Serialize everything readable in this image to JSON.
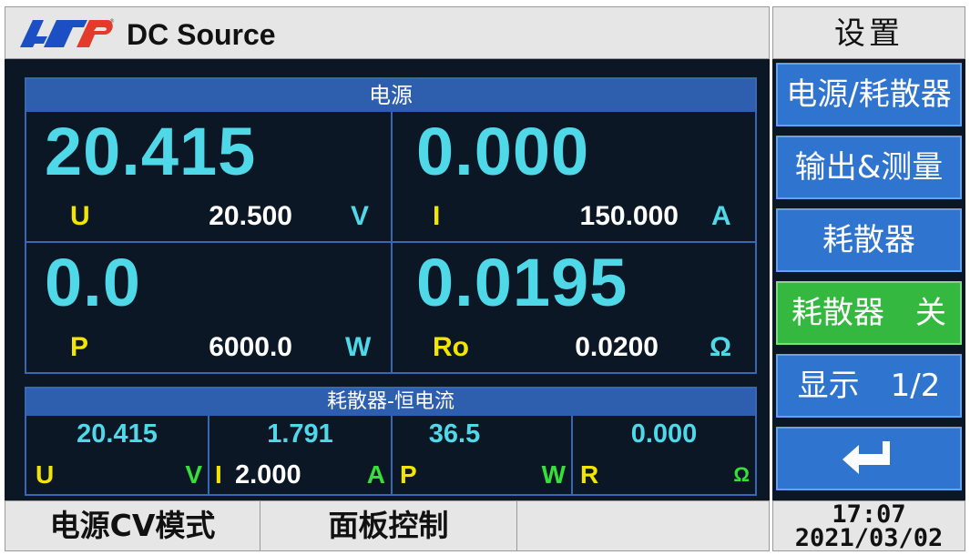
{
  "header": {
    "app_title": "DC Source",
    "logo_text": "ATP"
  },
  "side": {
    "title": "设置",
    "buttons": [
      "电源/耗散器",
      "输出&测量",
      "耗散器",
      "耗散器　关",
      "显示　1/2"
    ],
    "return_icon": "return-arrow-icon"
  },
  "source_panel": {
    "title": "电源",
    "cells": [
      {
        "big": "20.415",
        "label": "U",
        "set": "20.500",
        "unit": "V"
      },
      {
        "big": "0.000",
        "label": "I",
        "set": "150.000",
        "unit": "A"
      },
      {
        "big": "0.0",
        "label": "P",
        "set": "6000.0",
        "unit": "W"
      },
      {
        "big": "0.0195",
        "label": "Ro",
        "set": "0.0200",
        "unit": "Ω"
      }
    ]
  },
  "sink_panel": {
    "title": "耗散器-恒电流",
    "cells": [
      {
        "value": "20.415",
        "label": "U",
        "set": "",
        "unit": "V"
      },
      {
        "value": "1.791",
        "label": "I",
        "set": "2.000",
        "unit": "A"
      },
      {
        "value": "36.5",
        "label": "P",
        "set": "",
        "unit": "W"
      },
      {
        "value": "0.000",
        "label": "R",
        "set": "",
        "unit": "Ω"
      }
    ]
  },
  "status_bar": {
    "mode": "电源CV模式",
    "control": "面板控制",
    "empty": ""
  },
  "clock": {
    "time": "17:07",
    "date": "2021/03/02"
  },
  "colors": {
    "screen_bg": "#0c1726",
    "panel_border": "#3a67b5",
    "value": "#4fd8e8",
    "label": "#f2e600",
    "button": "#2f74cf",
    "button_active": "#34b83f",
    "unit_small": "#36e03a"
  }
}
